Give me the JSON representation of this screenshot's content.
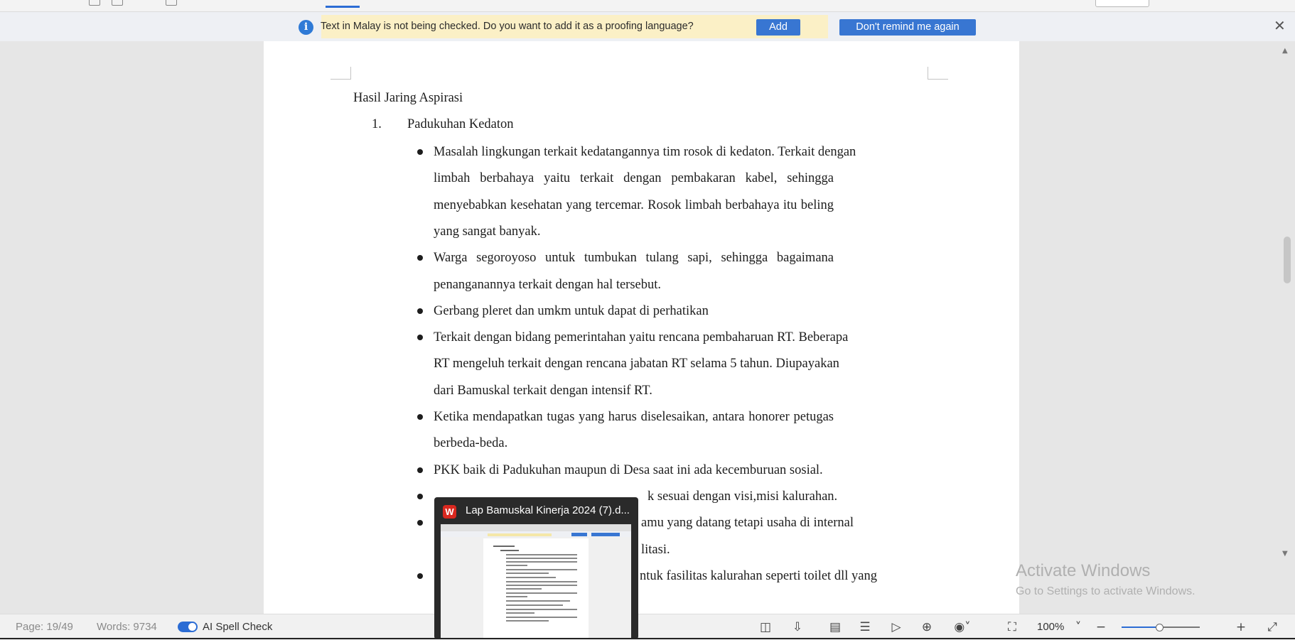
{
  "message_bar": {
    "text": "Text in Malay is not being checked. Do you want to add it as a proofing language?",
    "add_label": "Add",
    "dont_remind_label": "Don't remind me again",
    "accent_color": "#3876d2"
  },
  "document": {
    "heading": "Hasil Jaring Aspirasi",
    "list_number": "1.",
    "list_title": "Padukuhan Kedaton",
    "bullets": [
      [
        "Masalah lingkungan terkait kedatangannya tim rosok di kedaton. Terkait dengan",
        "limbah berbahaya yaitu terkait dengan pembakaran kabel, sehingga",
        "menyebabkan kesehatan yang tercemar. Rosok limbah berbahaya itu beling",
        "yang sangat banyak."
      ],
      [
        "Warga segoroyoso untuk tumbukan tulang sapi, sehingga bagaimana",
        "penanganannya terkait dengan hal tersebut."
      ],
      [
        "Gerbang pleret dan umkm untuk dapat di perhatikan"
      ],
      [
        "Terkait dengan bidang pemerintahan yaitu rencana pembaharuan RT. Beberapa",
        "RT mengeluh terkait dengan rencana jabatan RT selama 5 tahun. Diupayakan",
        "dari Bamuskal terkait dengan intensif RT."
      ],
      [
        "Ketika mendapatkan tugas yang harus diselesaikan, antara honorer petugas",
        "berbeda-beda."
      ],
      [
        "PKK baik di Padukuhan maupun di Desa saat ini ada kecemburuan sosial."
      ],
      [
        "k sesuai dengan visi,misi kalurahan."
      ],
      [
        "amu yang datang tetapi usaha di internal",
        "litasi."
      ],
      [
        "ntuk fasilitas kalurahan seperti toilet dll yang"
      ]
    ]
  },
  "status_bar": {
    "page": "Page: 19/49",
    "words": "Words: 9734",
    "ai_spell_check": "AI Spell Check",
    "zoom": "100%",
    "zoom_level_percent": 100,
    "ai_spell_check_on": true
  },
  "watermark": {
    "line1": "Activate Windows",
    "line2": "Go to Settings to activate Windows."
  },
  "taskbar_preview": {
    "title": "Lap Bamuskal Kinerja 2024 (7).d..."
  }
}
